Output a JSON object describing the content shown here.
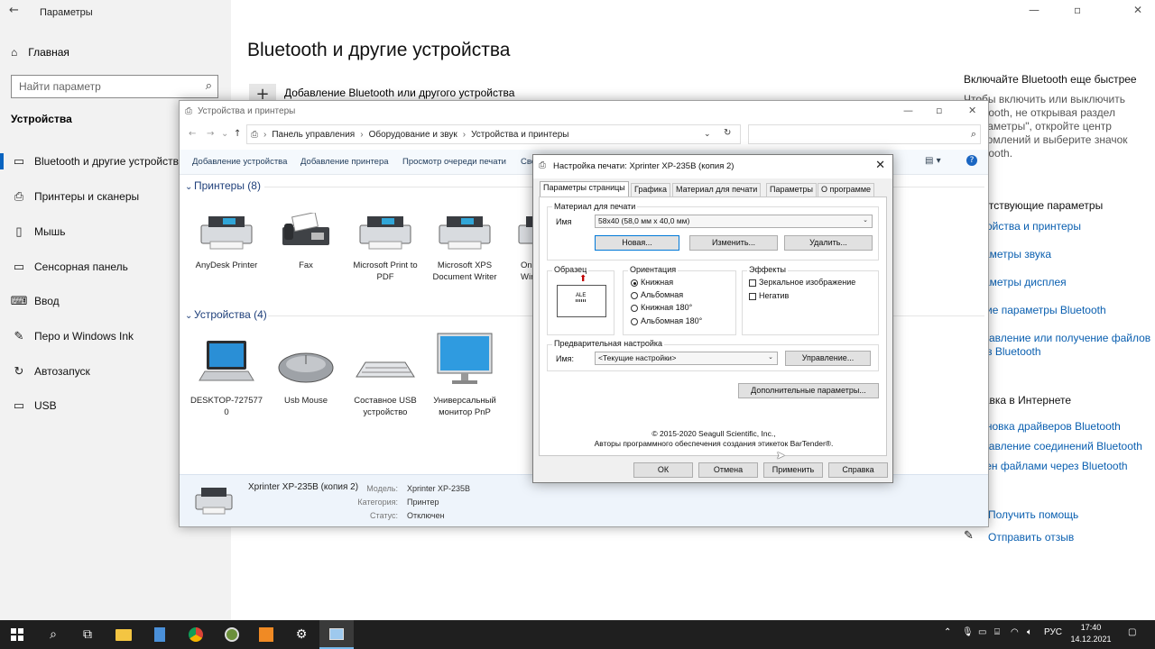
{
  "settings": {
    "app_title": "Параметры",
    "window_controls": {
      "minimize": "—",
      "maximize": "▫",
      "close": "✕"
    },
    "sidebar": {
      "home": "Главная",
      "search_placeholder": "Найти параметр",
      "section": "Устройства",
      "items": [
        {
          "label": "Bluetooth и другие устройства",
          "icon": "▭"
        },
        {
          "label": "Принтеры и сканеры",
          "icon": "⎙"
        },
        {
          "label": "Мышь",
          "icon": "▯"
        },
        {
          "label": "Сенсорная панель",
          "icon": "▭"
        },
        {
          "label": "Ввод",
          "icon": "⌨"
        },
        {
          "label": "Перо и Windows Ink",
          "icon": "✎"
        },
        {
          "label": "Автозапуск",
          "icon": "↻"
        },
        {
          "label": "USB",
          "icon": "▭"
        }
      ]
    },
    "main": {
      "title": "Bluetooth и другие устройства",
      "add_device": "Добавление Bluetooth или другого устройства"
    },
    "right_panel": {
      "heading1": "Включайте Bluetooth еще быстрее",
      "text_lines": [
        "Чтобы включить или выключить",
        "Bluetooth, не открывая раздел",
        "\"Параметры\", откройте центр",
        "уведомлений и выберите значок",
        "Bluetooth."
      ],
      "heading2": "Сопутствующие параметры",
      "related_links": [
        "Устройства и принтеры",
        "Параметры звука",
        "Параметры дисплея",
        "Другие параметры Bluetooth",
        "Отправление или получение файлов",
        "через Bluetooth"
      ],
      "heading3": "Справка в Интернете",
      "help_links": [
        "Установка драйверов Bluetooth",
        "Исправление соединений Bluetooth",
        "Обмен файлами через Bluetooth"
      ],
      "get_help": "Получить помощь",
      "feedback": "Отправить отзыв"
    }
  },
  "devices_window": {
    "title": "Устройства и принтеры",
    "breadcrumb": [
      "Панель управления",
      "Оборудование и звук",
      "Устройства и принтеры"
    ],
    "toolbar": [
      "Добавление устройства",
      "Добавление принтера",
      "Просмотр очереди печати",
      "Сво"
    ],
    "printers_group": "Принтеры (8)",
    "printers": [
      {
        "line1": "AnyDesk Printer",
        "line2": ""
      },
      {
        "line1": "Fax",
        "line2": ""
      },
      {
        "line1": "Microsoft Print to",
        "line2": "PDF"
      },
      {
        "line1": "Microsoft XPS",
        "line2": "Document Writer"
      },
      {
        "line1": "On",
        "line2": "Win"
      }
    ],
    "devices_group": "Устройства (4)",
    "devices": [
      {
        "line1": "DESKTOP-727577",
        "line2": "0"
      },
      {
        "line1": "Usb Mouse",
        "line2": ""
      },
      {
        "line1": "Составное USB",
        "line2": "устройство"
      },
      {
        "line1": "Универсальный",
        "line2": "монитор PnP"
      }
    ],
    "details": {
      "name": "Xprinter XP-235B (копия 2)",
      "model_label": "Модель:",
      "model_value": "Xprinter XP-235B",
      "category_label": "Категория:",
      "category_value": "Принтер",
      "status_label": "Статус:",
      "status_value": "Отключен"
    }
  },
  "dialog": {
    "title": "Настройка печати: Xprinter XP-235B (копия 2)",
    "tabs": [
      "Параметры страницы",
      "Графика",
      "Материал для печати",
      "Параметры",
      "О программе"
    ],
    "material_legend": "Материал для печати",
    "name_label": "Имя",
    "material_value": "58x40 (58,0 мм x 40,0 мм)",
    "btn_new": "Новая...",
    "btn_change": "Изменить...",
    "btn_delete": "Удалить...",
    "sample_legend": "Образец",
    "sample_text": "ALE",
    "orientation_legend": "Ориентация",
    "orientations": [
      "Книжная",
      "Альбомная",
      "Книжная 180°",
      "Альбомная 180°"
    ],
    "effects_legend": "Эффекты",
    "effects": [
      "Зеркальное изображение",
      "Негатив"
    ],
    "preset_legend": "Предварительная настройка",
    "preset_name_label": "Имя:",
    "preset_value": "<Текущие настройки>",
    "btn_manage": "Управление...",
    "btn_advanced": "Дополнительные параметры...",
    "copyright1": "© 2015-2020 Seagull Scientific, Inc.,",
    "copyright2": "Авторы программного обеспечения создания этикеток BarTender®.",
    "btn_ok": "ОК",
    "btn_cancel": "Отмена",
    "btn_apply": "Применить",
    "btn_help": "Справка"
  },
  "taskbar": {
    "lang": "РУС",
    "time": "17:40",
    "date": "14.12.2021"
  }
}
